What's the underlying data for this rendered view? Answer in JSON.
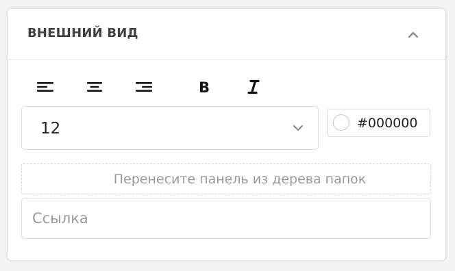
{
  "panel": {
    "title": "ВНЕШНИЙ ВИД"
  },
  "toolbar": {
    "buttons": [
      {
        "name": "align-left",
        "icon": "align-left-icon"
      },
      {
        "name": "align-center",
        "icon": "align-center-icon"
      },
      {
        "name": "align-right",
        "icon": "align-right-icon"
      },
      {
        "name": "bold",
        "icon": "bold-icon"
      },
      {
        "name": "italic",
        "icon": "italic-icon"
      }
    ]
  },
  "font_size": {
    "value": "12",
    "icon": "chevron-down-icon"
  },
  "color": {
    "value": "#000000",
    "swatch": "#ffffff"
  },
  "drop_zone": {
    "text": "Перенесите панель из дерева папок"
  },
  "link": {
    "placeholder": "Ссылка",
    "value": ""
  },
  "colors": {
    "text": "#222222",
    "muted": "#9a9a9a",
    "border": "#dddddd",
    "icon": "#111111"
  }
}
